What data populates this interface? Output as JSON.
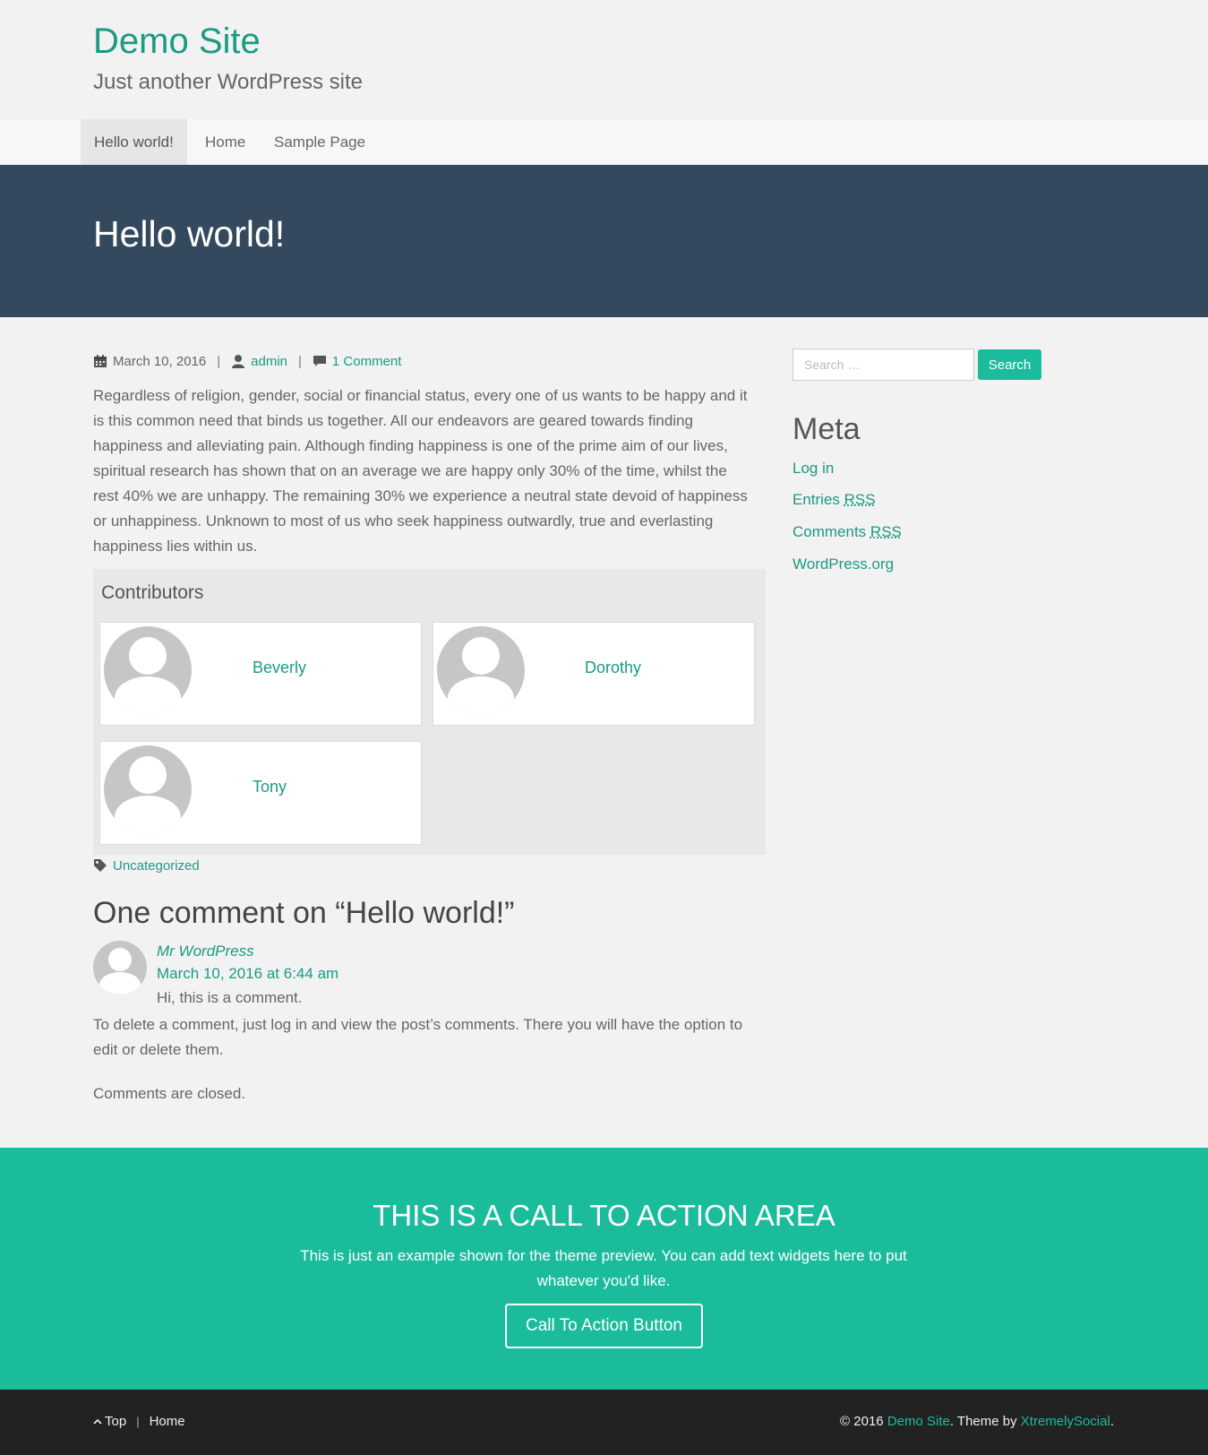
{
  "site": {
    "title": "Demo Site",
    "tagline": "Just another WordPress site"
  },
  "nav": {
    "items": [
      {
        "label": "Hello world!"
      },
      {
        "label": "Home"
      },
      {
        "label": "Sample Page"
      }
    ]
  },
  "post": {
    "title": "Hello world!",
    "date": "March 10, 2016",
    "author": "admin",
    "comments_link": "1 Comment",
    "meta_separator": "|",
    "body": "Regardless of religion, gender, social or financial status, every one of us wants to be happy and it is this common need that binds us together. All our endeavors are geared towards finding happiness and alleviating pain. Although finding happiness is one of the prime aim of our lives, spiritual research has shown that on an average we are happy only 30% of the time, whilst the rest 40% we are unhappy. The remaining 30% we experience a neutral state devoid of happiness or unhappiness. Unknown to most of us who seek happiness outwardly, true and everlasting happiness lies within us.",
    "category": "Uncategorized"
  },
  "contributors": {
    "title": "Contributors",
    "people": [
      {
        "name": "Beverly"
      },
      {
        "name": "Dorothy"
      },
      {
        "name": "Tony"
      }
    ]
  },
  "comments": {
    "heading": "One comment on “Hello world!”",
    "items": [
      {
        "author": "Mr WordPress",
        "date": "March 10, 2016 at 6:44 am",
        "line1": "Hi, this is a comment.",
        "line2": "To delete a comment, just log in and view the post’s comments. There you will have the option to edit or delete them."
      }
    ],
    "closed_text": "Comments are closed."
  },
  "sidebar": {
    "search_placeholder": "Search …",
    "search_button": "Search",
    "meta_title": "Meta",
    "meta_links": [
      {
        "label": "Log in"
      },
      {
        "label_prefix": "Entries ",
        "abbr": "RSS"
      },
      {
        "label_prefix": "Comments ",
        "abbr": "RSS"
      },
      {
        "label": "WordPress.org"
      }
    ]
  },
  "cta": {
    "title": "THIS IS A CALL TO ACTION AREA",
    "text": "This is just an example shown for the theme preview. You can add text widgets here to put whatever you'd like.",
    "button": "Call To Action Button"
  },
  "footer": {
    "top_link": "Top",
    "home_link": "Home",
    "separator": "|",
    "copyright": "© 2016",
    "site_link": "Demo Site",
    "theme_by": ". Theme by",
    "theme_link": "XtremelySocial",
    "period": "."
  },
  "colors": {
    "accent": "#1abc9c",
    "link": "#1a9b82",
    "hero_bg": "#34495e",
    "footer_bg": "#222222"
  }
}
